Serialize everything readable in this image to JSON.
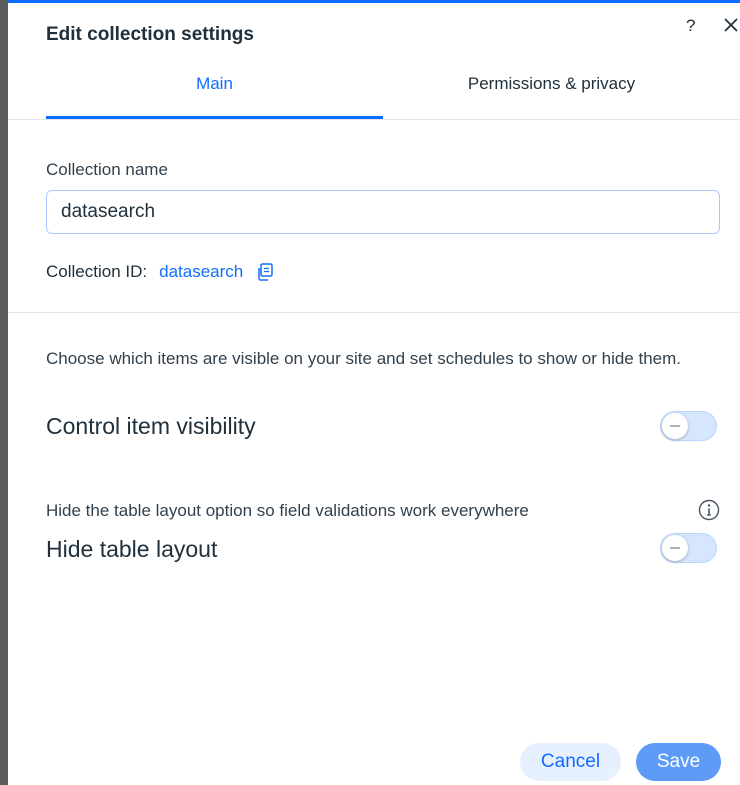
{
  "dialog": {
    "title": "Edit collection settings",
    "help_icon": "?",
    "close_icon": "close-icon"
  },
  "tabs": [
    {
      "label": "Main",
      "active": true
    },
    {
      "label": "Permissions & privacy",
      "active": false
    }
  ],
  "collection_name": {
    "label": "Collection name",
    "value": "datasearch"
  },
  "collection_id": {
    "label": "Collection ID:",
    "value": "datasearch",
    "copy_icon": "copy-icon"
  },
  "item_visibility": {
    "description": "Choose which items are visible on your site and set schedules to show or hide them.",
    "label": "Control item visibility",
    "enabled": false
  },
  "table_layout": {
    "description": "Hide the table layout option so field validations work everywhere",
    "label": "Hide table layout",
    "enabled": false,
    "info_icon": "info-icon"
  },
  "footer": {
    "cancel_label": "Cancel",
    "save_label": "Save"
  },
  "colors": {
    "accent": "#116dff",
    "text": "#20303c",
    "toggle_off_bg": "#d6e6fe",
    "save_bg": "#5d9bf6",
    "cancel_bg": "#e7f0ff"
  }
}
